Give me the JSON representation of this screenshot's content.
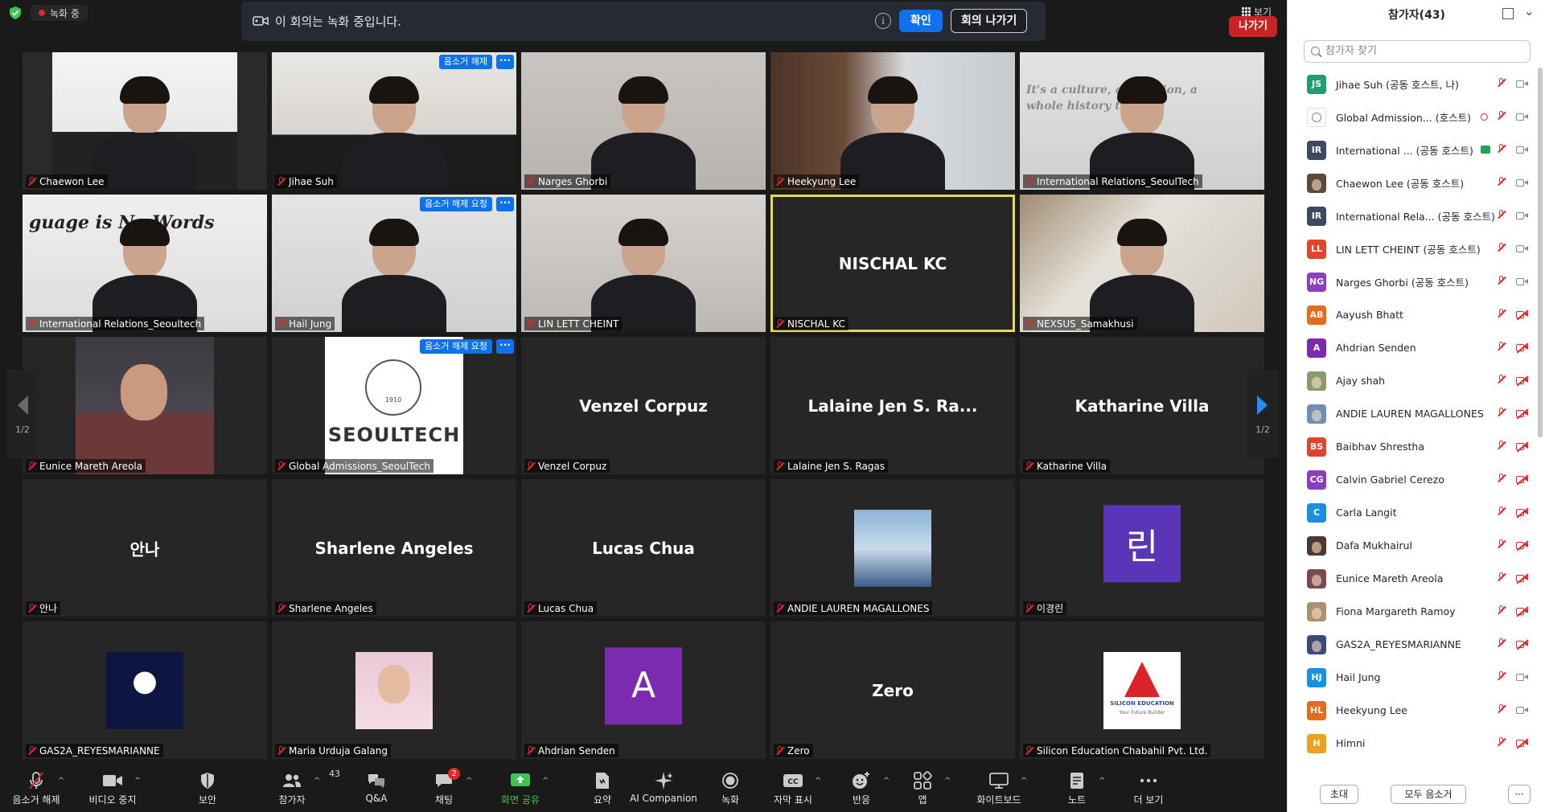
{
  "top": {
    "recording": "녹화 중",
    "banner_msg": "이 회의는 녹화 중입니다.",
    "confirm": "확인",
    "leave_meeting": "회의 나가기",
    "view": "보기"
  },
  "tiles": [
    {
      "name": "Chaewon Lee",
      "kind": "video"
    },
    {
      "name": "Jihae Suh",
      "kind": "video",
      "tag": "음소거 해제"
    },
    {
      "name": "Narges Ghorbi",
      "kind": "video"
    },
    {
      "name": "Heekyung Lee",
      "kind": "video"
    },
    {
      "name": "International Relations_SeoulTech",
      "kind": "video",
      "sign": "It's a culture, a tradition, a whole history that cre"
    },
    {
      "name": "International Relations_Seoultech",
      "kind": "video",
      "sign": "guage is No  Words"
    },
    {
      "name": "Hail Jung",
      "kind": "video",
      "tag": "음소거 해제 요청"
    },
    {
      "name": "LIN LETT CHEINT",
      "kind": "video"
    },
    {
      "name": "NISCHAL KC",
      "kind": "name",
      "big": "NISCHAL KC",
      "active": true
    },
    {
      "name": "NEXSUS_Samakhusi",
      "kind": "video"
    },
    {
      "name": "Eunice Mareth Areola",
      "kind": "photo"
    },
    {
      "name": "Global Admissions_SeoulTech",
      "kind": "logo",
      "tag": "음소거 해제 요청",
      "logo_text": "SEOULTECH",
      "logo_year": "1910"
    },
    {
      "name": "Venzel Corpuz",
      "kind": "name",
      "big": "Venzel Corpuz"
    },
    {
      "name": "Lalaine Jen S. Ragas",
      "kind": "name",
      "big": "Lalaine Jen S. Ra..."
    },
    {
      "name": "Katharine Villa",
      "kind": "name",
      "big": "Katharine Villa"
    },
    {
      "name": "안나",
      "kind": "name",
      "big": "안나"
    },
    {
      "name": "Sharlene Angeles",
      "kind": "name",
      "big": "Sharlene Angeles"
    },
    {
      "name": "Lucas Chua",
      "kind": "name",
      "big": "Lucas Chua"
    },
    {
      "name": "ANDIE LAUREN MAGALLONES",
      "kind": "pic"
    },
    {
      "name": "이경린",
      "kind": "avatar",
      "letter": "린",
      "color": "#5b35b8"
    },
    {
      "name": "GAS2A_REYESMARIANNE",
      "kind": "pic"
    },
    {
      "name": "Maria Urduja Galang",
      "kind": "pic"
    },
    {
      "name": "Ahdrian Senden",
      "kind": "avatar",
      "letter": "A",
      "color": "#7a2bb0"
    },
    {
      "name": "Zero",
      "kind": "name",
      "big": "Zero"
    },
    {
      "name": "Silicon Education Chabahil Pvt. Ltd.",
      "kind": "silicon",
      "logo_text": "SILICON EDUCATION",
      "logo_sub": "Your Future Builder"
    }
  ],
  "pager": {
    "left": "1/2",
    "right": "1/2"
  },
  "more_tag": "···",
  "toolbar": [
    {
      "label": "음소거 해제",
      "icon": "mic-off-icon"
    },
    {
      "label": "비디오 중지",
      "icon": "video-icon"
    },
    {
      "label": "보안",
      "icon": "security-shield-icon"
    },
    {
      "label": "참가자",
      "icon": "participants-icon",
      "count": "43"
    },
    {
      "label": "Q&A",
      "icon": "qa-icon"
    },
    {
      "label": "채팅",
      "icon": "chat-icon",
      "badge": "2"
    },
    {
      "label": "화면 공유",
      "icon": "share-screen-icon"
    },
    {
      "label": "요약",
      "icon": "summary-icon"
    },
    {
      "label": "AI Companion",
      "icon": "ai-companion-icon"
    },
    {
      "label": "녹화",
      "icon": "record-icon"
    },
    {
      "label": "자막 표시",
      "icon": "cc-icon"
    },
    {
      "label": "반응",
      "icon": "reaction-icon"
    },
    {
      "label": "앱",
      "icon": "apps-icon"
    },
    {
      "label": "화이트보드",
      "icon": "whiteboard-icon"
    },
    {
      "label": "노트",
      "icon": "notes-icon"
    },
    {
      "label": "더 보기",
      "icon": "more-icon"
    }
  ],
  "leave": "나가기",
  "panel": {
    "title": "참가자(43)",
    "search_placeholder": "참가자 찾기",
    "invite": "초대",
    "mute_all": "모두 음소거",
    "more": "···",
    "participants": [
      {
        "initials": "JS",
        "color": "#1f9e6e",
        "name": "Jihae Suh (공동 호스트, 나)",
        "cam": "on"
      },
      {
        "initials": "",
        "color": "#ffffff",
        "name": "Global Admission...  (호스트)",
        "cam": "on",
        "rec": true,
        "logo": true
      },
      {
        "initials": "IR",
        "color": "#3b4a5e",
        "name": "International ...  (공동 호스트)",
        "cam": "on",
        "share": true
      },
      {
        "initials": "",
        "color": "#5a4a3a",
        "name": "Chaewon Lee (공동 호스트)",
        "cam": "on",
        "photo": true
      },
      {
        "initials": "IR",
        "color": "#3b4a5e",
        "name": "International Rela... (공동 호스트)",
        "cam": "on"
      },
      {
        "initials": "LL",
        "color": "#e0452c",
        "name": "LIN LETT CHEINT (공동 호스트)",
        "cam": "on"
      },
      {
        "initials": "NG",
        "color": "#8a3fbf",
        "name": "Narges Ghorbi (공동 호스트)",
        "cam": "on"
      },
      {
        "initials": "AB",
        "color": "#e86a1f",
        "name": "Aayush Bhatt",
        "cam": "off"
      },
      {
        "initials": "A",
        "color": "#7a2bb0",
        "name": "Ahdrian Senden",
        "cam": "off"
      },
      {
        "initials": "",
        "color": "#8a9a70",
        "name": "Ajay shah",
        "cam": "off",
        "photo": true
      },
      {
        "initials": "",
        "color": "#6b8fb5",
        "name": "ANDIE LAUREN MAGALLONES",
        "cam": "off",
        "photo": true
      },
      {
        "initials": "BS",
        "color": "#e0452c",
        "name": "Baibhav Shrestha",
        "cam": "off"
      },
      {
        "initials": "CG",
        "color": "#8a3fbf",
        "name": "Calvin Gabriel Cerezo",
        "cam": "off"
      },
      {
        "initials": "C",
        "color": "#1a8fe0",
        "name": "Carla Langit",
        "cam": "off"
      },
      {
        "initials": "",
        "color": "#4a3a30",
        "name": "Dafa Mukhairul",
        "cam": "off",
        "photo": true
      },
      {
        "initials": "",
        "color": "#7a4a50",
        "name": "Eunice Mareth Areola",
        "cam": "off",
        "photo": true
      },
      {
        "initials": "",
        "color": "#a89070",
        "name": "Fiona Margareth Ramoy",
        "cam": "off",
        "photo": true
      },
      {
        "initials": "",
        "color": "#3a4a7a",
        "name": "GAS2A_REYESMARIANNE",
        "cam": "off",
        "photo": true
      },
      {
        "initials": "HJ",
        "color": "#1a8fe0",
        "name": "Hail Jung",
        "cam": "on"
      },
      {
        "initials": "HL",
        "color": "#e86a1f",
        "name": "Heekyung Lee",
        "cam": "on"
      },
      {
        "initials": "H",
        "color": "#f0a020",
        "name": "Himni",
        "cam": "off"
      }
    ]
  }
}
